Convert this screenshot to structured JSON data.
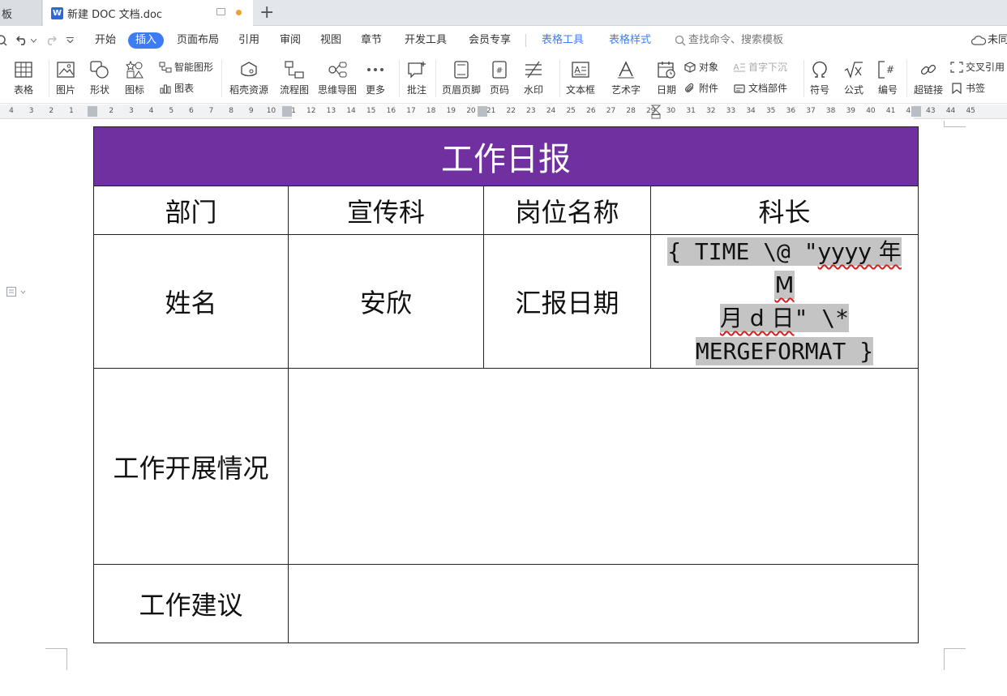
{
  "tabs": {
    "prev_tab": "板",
    "doc_tab_icon": "W",
    "doc_tab_title": "新建 DOC 文档.doc",
    "new_tab": "+"
  },
  "menu": {
    "items": [
      "开始",
      "插入",
      "页面布局",
      "引用",
      "审阅",
      "视图",
      "章节",
      "开发工具",
      "会员专享"
    ],
    "active": "插入",
    "context_tabs": [
      "表格工具",
      "表格样式"
    ],
    "search_placeholder": "查找命令、搜索模板",
    "cloud_status": "未同"
  },
  "ribbon": {
    "table": "表格",
    "picture": "图片",
    "shape": "形状",
    "icon": "图标",
    "smart_shape": "智能图形",
    "chart": "图表",
    "docer_resources": "稻壳资源",
    "flowchart": "流程图",
    "mind_map": "思维导图",
    "more": "更多",
    "comment": "批注",
    "header_footer": "页眉页脚",
    "page_number": "页码",
    "watermark": "水印",
    "text_box": "文本框",
    "word_art": "艺术字",
    "date": "日期",
    "object": "对象",
    "attachment": "附件",
    "drop_cap": "首字下沉",
    "doc_parts": "文档部件",
    "symbol": "符号",
    "formula": "公式",
    "numbering": "编号",
    "hyperlink": "超链接",
    "cross_reference": "交叉引用",
    "bookmark": "书签"
  },
  "ruler": {
    "numbers": [
      "4",
      "3",
      "2",
      "1",
      "1",
      "2",
      "3",
      "4",
      "5",
      "6",
      "7",
      "8",
      "9",
      "10",
      "11",
      "12",
      "13",
      "14",
      "15",
      "16",
      "17",
      "18",
      "19",
      "20",
      "21",
      "22",
      "23",
      "24",
      "25",
      "26",
      "27",
      "28",
      "29",
      "30",
      "31",
      "32",
      "33",
      "34",
      "35",
      "36",
      "37",
      "38",
      "39",
      "40",
      "41",
      "42",
      "43",
      "44",
      "45"
    ]
  },
  "document": {
    "table_title": "工作日报",
    "dept_label": "部门",
    "dept_value": "宣传科",
    "position_label": "岗位名称",
    "position_value": "科长",
    "name_label": "姓名",
    "name_value": "安欣",
    "report_date_label": "汇报日期",
    "field_code": {
      "part1": "{ TIME \\@ \"",
      "part2": "yyyy 年 M",
      "part3": "月 d 日",
      "part4": "\" \\*",
      "part5": "MERGEFORMAT }"
    },
    "work_progress_label": "工作开展情况",
    "work_suggestion_label": "工作建议"
  },
  "colors": {
    "title_bg": "#7030a0",
    "accent_blue": "#3e7cf5",
    "field_highlight": "#c4c4c4",
    "squiggle": "#d42020"
  }
}
